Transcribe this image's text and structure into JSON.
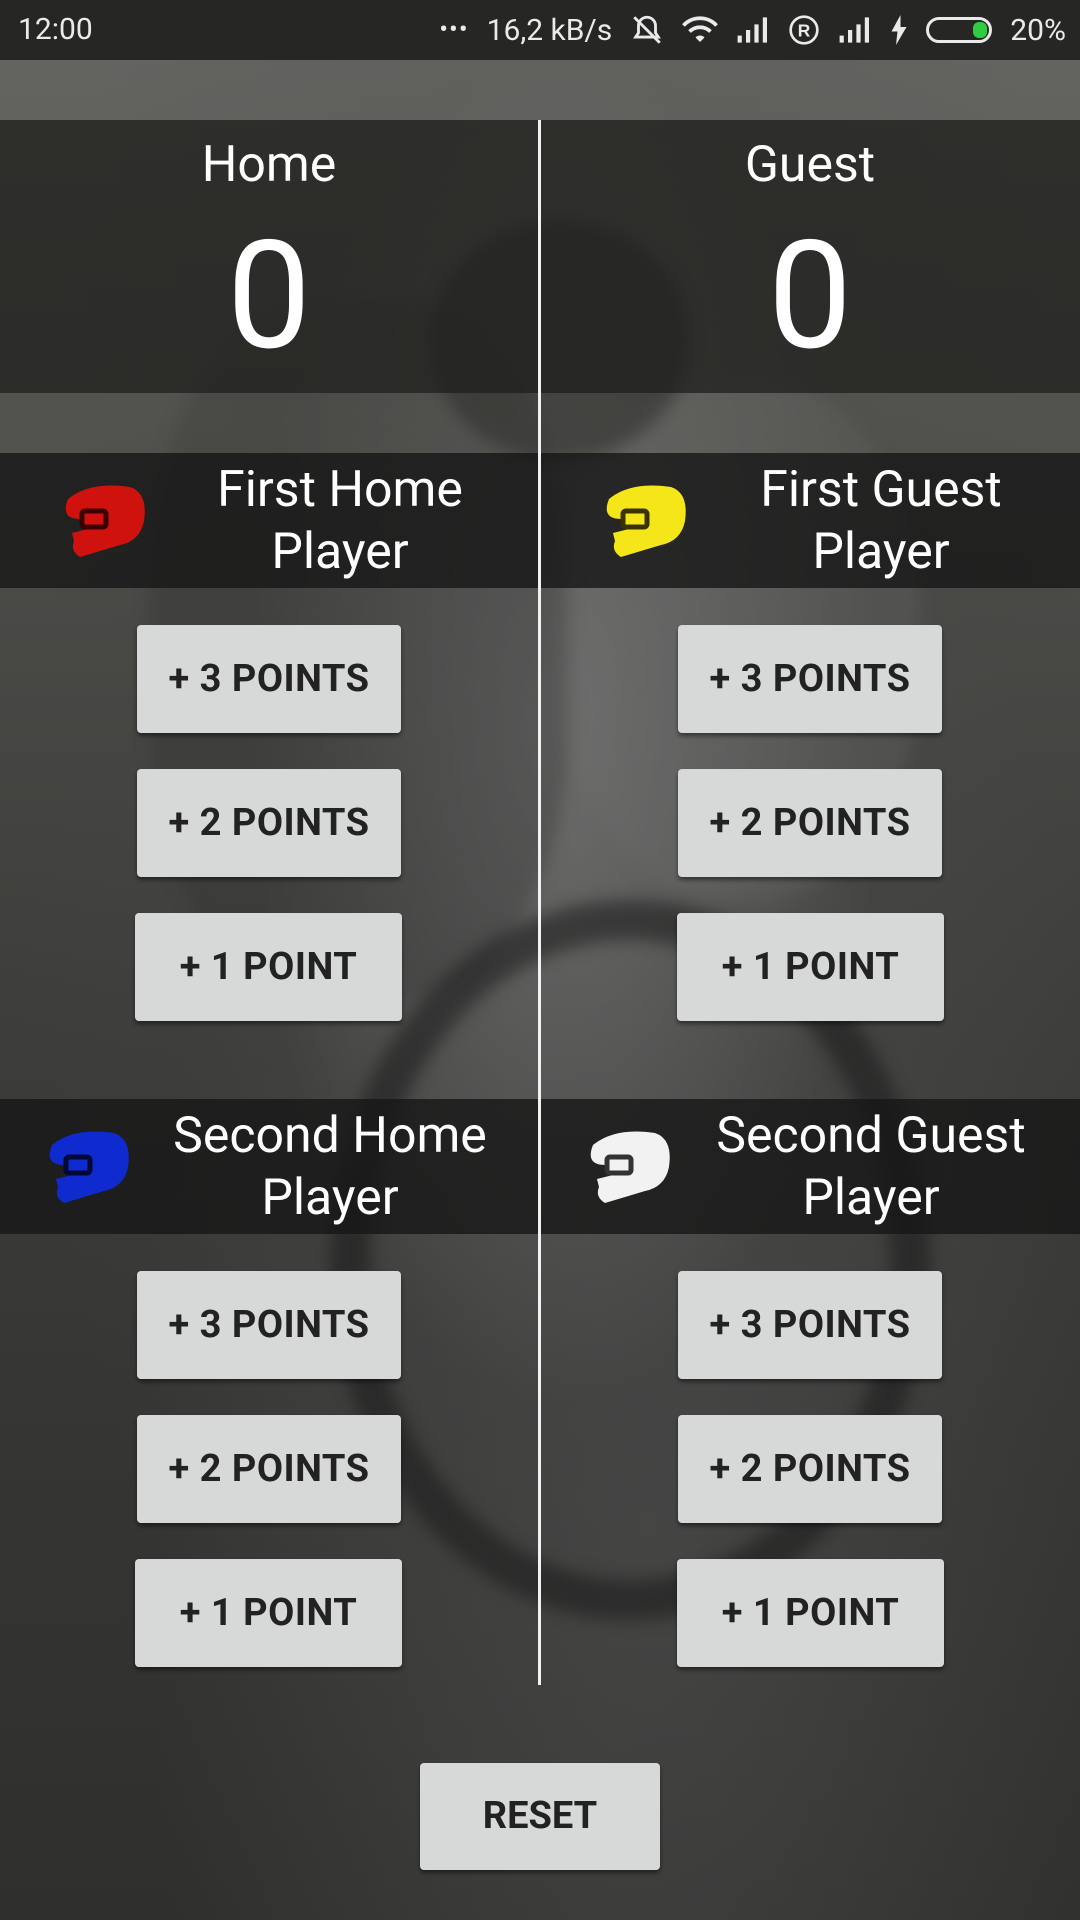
{
  "status_bar": {
    "time": "12:00",
    "dots": "•••",
    "speed": "16,2 kB/s",
    "battery": "20%",
    "icons": [
      "mute-icon",
      "wifi-icon",
      "signal-icon",
      "roaming-icon",
      "signal-icon-2",
      "charging-icon",
      "battery-icon"
    ]
  },
  "teams": {
    "home": {
      "name": "Home",
      "score": "0"
    },
    "guest": {
      "name": "Guest",
      "score": "0"
    }
  },
  "players": {
    "first_home": {
      "line1": "First Home",
      "line2": "Player",
      "helmet_color": "#d0120f"
    },
    "first_guest": {
      "line1": "First Guest",
      "line2": "Player",
      "helmet_color": "#f5e61a"
    },
    "second_home": {
      "line1": "Second Home",
      "line2": "Player",
      "helmet_color": "#0f2bd0"
    },
    "second_guest": {
      "line1": "Second Guest",
      "line2": "Player",
      "helmet_color": "#f2f2f2"
    }
  },
  "buttons": {
    "plus3": "+ 3 POINTS",
    "plus2": "+ 2 POINTS",
    "plus1": "+ 1 POINT",
    "reset": "RESET"
  }
}
